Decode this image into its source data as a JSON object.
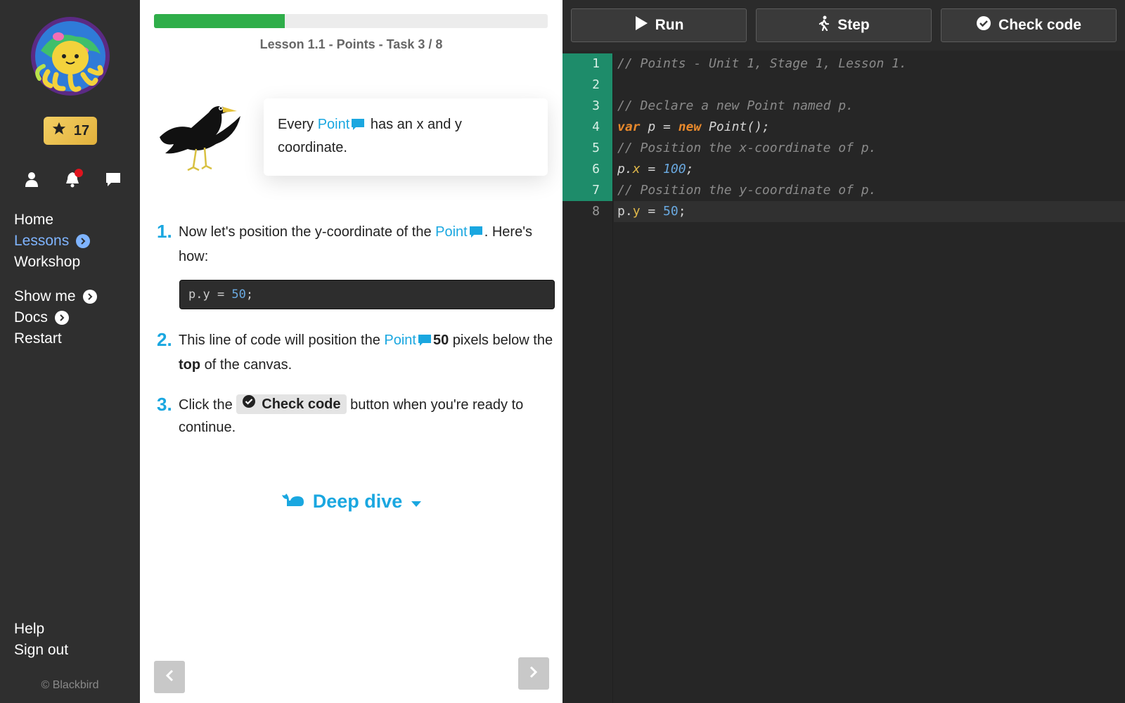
{
  "sidebar": {
    "stars": "17",
    "nav_primary": [
      {
        "label": "Home",
        "active": false,
        "chevron": false
      },
      {
        "label": "Lessons",
        "active": true,
        "chevron": true
      },
      {
        "label": "Workshop",
        "active": false,
        "chevron": false
      }
    ],
    "nav_secondary": [
      {
        "label": "Show me",
        "chevron": true
      },
      {
        "label": "Docs",
        "chevron": true
      },
      {
        "label": "Restart",
        "chevron": false
      }
    ],
    "nav_bottom": [
      {
        "label": "Help"
      },
      {
        "label": "Sign out"
      }
    ],
    "copyright": "© Blackbird"
  },
  "lesson": {
    "progress": 0.333,
    "task_title": "Lesson 1.1 - Points - Task 3 / 8",
    "bubble": {
      "pre": "Every ",
      "keyword": "Point",
      "post": " has an x and y coordinate."
    },
    "steps": {
      "s1": {
        "num": "1.",
        "pre": "Now let's position the y-coordinate of the ",
        "keyword": "Point",
        "post": ". Here's how:"
      },
      "s2": {
        "num": "2.",
        "pre": "This line of code will position the ",
        "keyword": "Point",
        "bold1": "50",
        "mid": " pixels below the ",
        "bold2": "top",
        "post": " of the canvas."
      },
      "s3": {
        "num": "3.",
        "pre": "Click the ",
        "button": "Check code",
        "post": " button when you're ready to continue."
      }
    },
    "snippet": {
      "pre": "p.y = ",
      "num": "50",
      "post": ";"
    },
    "deep_dive": "Deep dive"
  },
  "editor": {
    "toolbar": {
      "run": "Run",
      "step": "Step",
      "check": "Check code"
    },
    "line_numbers": [
      "1",
      "2",
      "3",
      "4",
      "5",
      "6",
      "7",
      "8"
    ],
    "lines": {
      "l1": "// Points - Unit 1, Stage 1, Lesson 1.",
      "l3": "// Declare a new Point named p.",
      "l4": {
        "kw1": "var",
        "mid1": " p = ",
        "kw2": "new",
        "mid2": " Point();"
      },
      "l5": "// Position the x-coordinate of p.",
      "l6": {
        "obj": "p.",
        "prop": "x",
        "eq": " = ",
        "num": "100",
        "end": ";"
      },
      "l7": "// Position the y-coordinate of p.",
      "l8": {
        "obj": "p.",
        "prop": "y",
        "eq": " = ",
        "num": "50",
        "end": ";"
      }
    }
  },
  "colors": {
    "accent": "#1aa7e0",
    "progress": "#2fae4a",
    "highlight_gutter": "#1e8c6a"
  }
}
